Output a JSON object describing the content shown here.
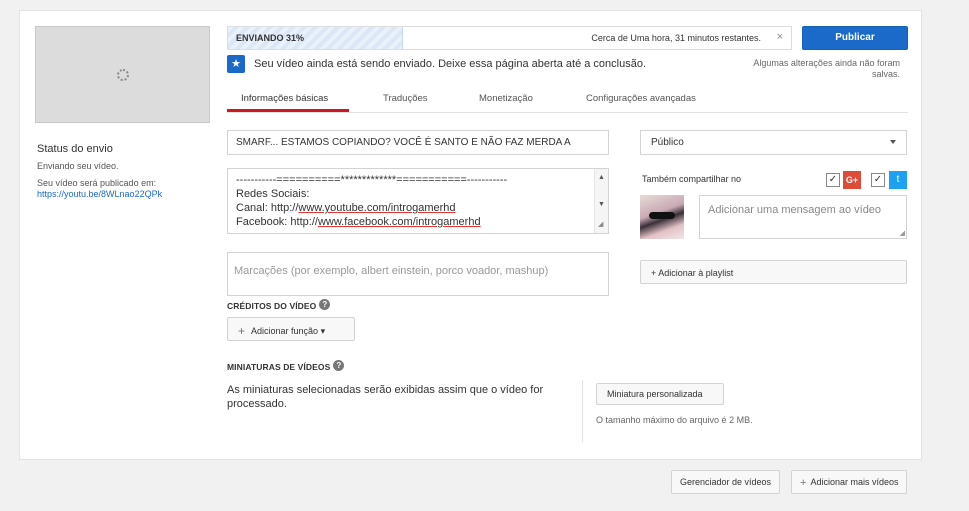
{
  "status": {
    "title": "Status do envio",
    "subtitle": "Enviando seu vídeo.",
    "publish_note": "Seu vídeo será publicado em:",
    "link": "https://youtu.be/8WLnao22QPk"
  },
  "upload": {
    "label": "ENVIANDO 31%",
    "progress_percent": 31,
    "remaining": "Cerca de Uma hora, 31 minutos restantes.",
    "close_symbol": "×"
  },
  "publish_label": "Publicar",
  "notice": {
    "text": "Seu vídeo ainda está sendo enviado. Deixe essa página aberta até a conclusão.",
    "save_note": "Algumas alterações ainda não foram salvas."
  },
  "tabs": [
    {
      "label": "Informações básicas",
      "active": true
    },
    {
      "label": "Traduções",
      "active": false
    },
    {
      "label": "Monetização",
      "active": false
    },
    {
      "label": "Configurações avançadas",
      "active": false
    }
  ],
  "form": {
    "title_value": "SMARF... ESTAMOS COPIANDO? VOCÊ É SANTO E NÃO FAZ MERDA A",
    "description_lines": [
      {
        "prefix": "-----------==========*************===========-----------",
        "link": "",
        "suffix": ""
      },
      {
        "prefix": "Redes Sociais:",
        "link": "",
        "suffix": ""
      },
      {
        "prefix": "Canal: http://",
        "link": "www.youtube.com/introgamerhd",
        "suffix": ""
      },
      {
        "prefix": "Facebook: http://",
        "link": "www.facebook.com/introgamerhd",
        "suffix": ""
      }
    ],
    "tags_placeholder": "Marcações (por exemplo, albert einstein, porco voador, mashup)"
  },
  "credits": {
    "title": "CRÉDITOS DO VÍDEO",
    "help": "?",
    "add_function": "Adicionar função",
    "plus": "+",
    "caret": "▾"
  },
  "thumbnails": {
    "title": "MINIATURAS DE VÍDEOS",
    "help": "?",
    "description": "As miniaturas selecionadas serão exibidas assim que o vídeo for processado.",
    "custom_button": "Miniatura personalizada",
    "size_note": "O tamanho máximo do arquivo é 2 MB."
  },
  "sidebar": {
    "privacy": "Público",
    "share_label": "Também compartilhar no",
    "gplus_symbol": "G+",
    "twitter_symbol": "t",
    "check_symbol": "✓",
    "message_placeholder": "Adicionar uma mensagem ao vídeo",
    "playlist_button": "+ Adicionar à playlist"
  },
  "footer": {
    "manager_button": "Gerenciador de vídeos",
    "add_more_button": "Adicionar mais vídeos",
    "plus": "+"
  },
  "colors": {
    "accent": "#1b6ac9",
    "tab_underline": "#cc181e",
    "gplus": "#dd4b39",
    "twitter": "#1da1f2"
  }
}
